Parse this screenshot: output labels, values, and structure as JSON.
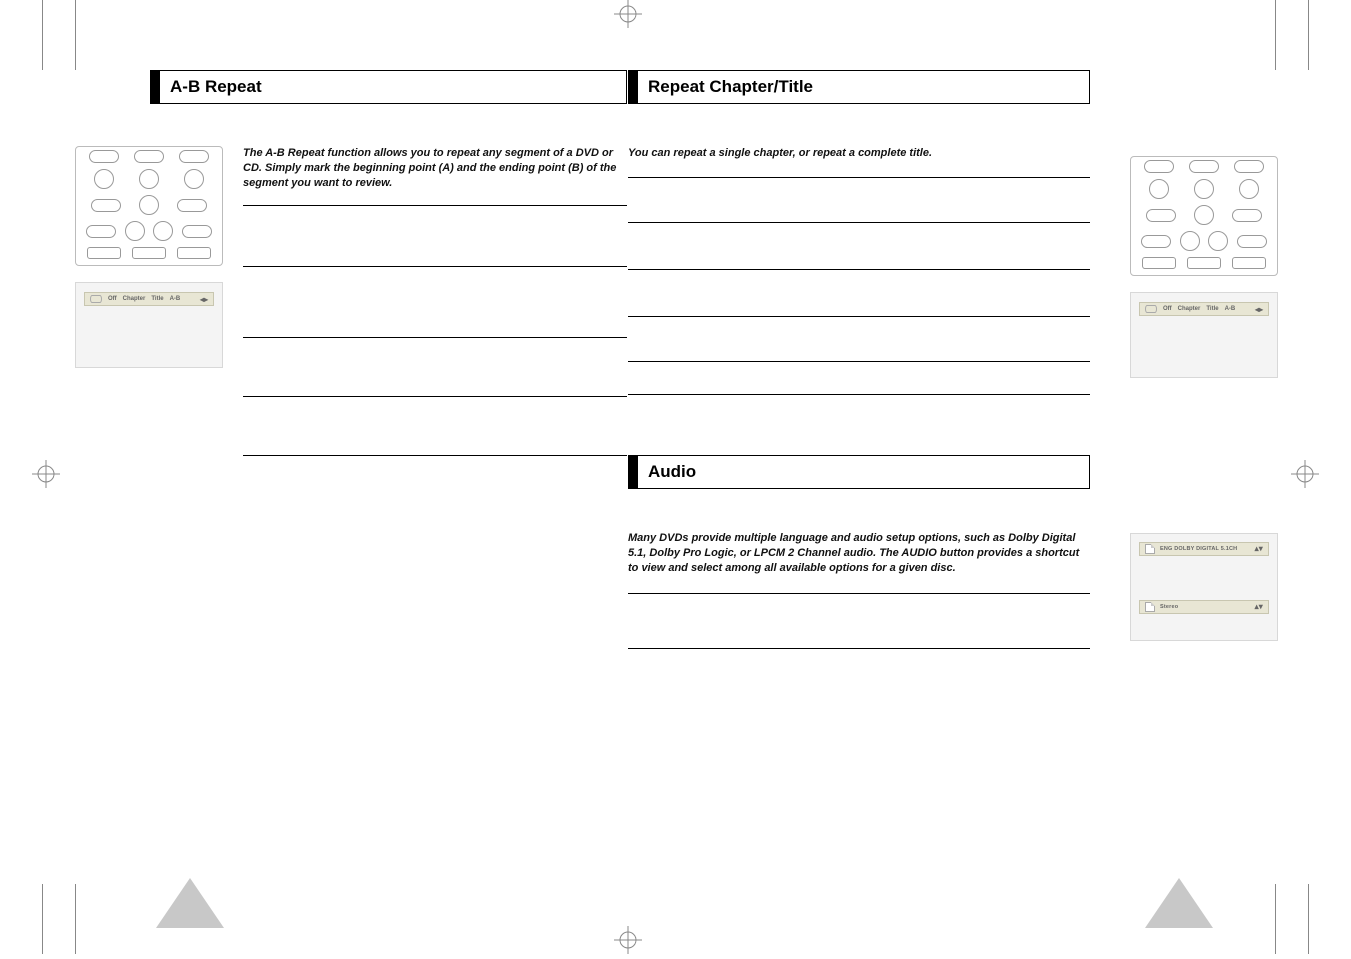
{
  "left_page": {
    "title": "A-B Repeat",
    "intro": "The A-B Repeat function allows you to repeat any segment of a DVD or CD. Simply mark the beginning point (A) and the ending point (B) of the segment you want to review.",
    "osd": {
      "off": "Off",
      "chapter": "Chapter",
      "title": "Title",
      "ab": "A-B"
    }
  },
  "right_page": {
    "repeat_title": "Repeat Chapter/Title",
    "repeat_intro": "You can repeat a single chapter, or repeat a complete title.",
    "repeat_osd": {
      "off": "Off",
      "chapter": "Chapter",
      "title": "Title",
      "ab": "A-B"
    },
    "audio_title": "Audio",
    "audio_intro": "Many DVDs provide multiple language and audio setup options, such as Dolby Digital 5.1, Dolby Pro Logic, or LPCM 2 Channel audio. The AUDIO button provides a shortcut to view and select among all available options for a given disc.",
    "audio_osd1": "ENG  DOLBY  DIGITAL  5.1CH",
    "audio_osd2": "Stereo"
  }
}
